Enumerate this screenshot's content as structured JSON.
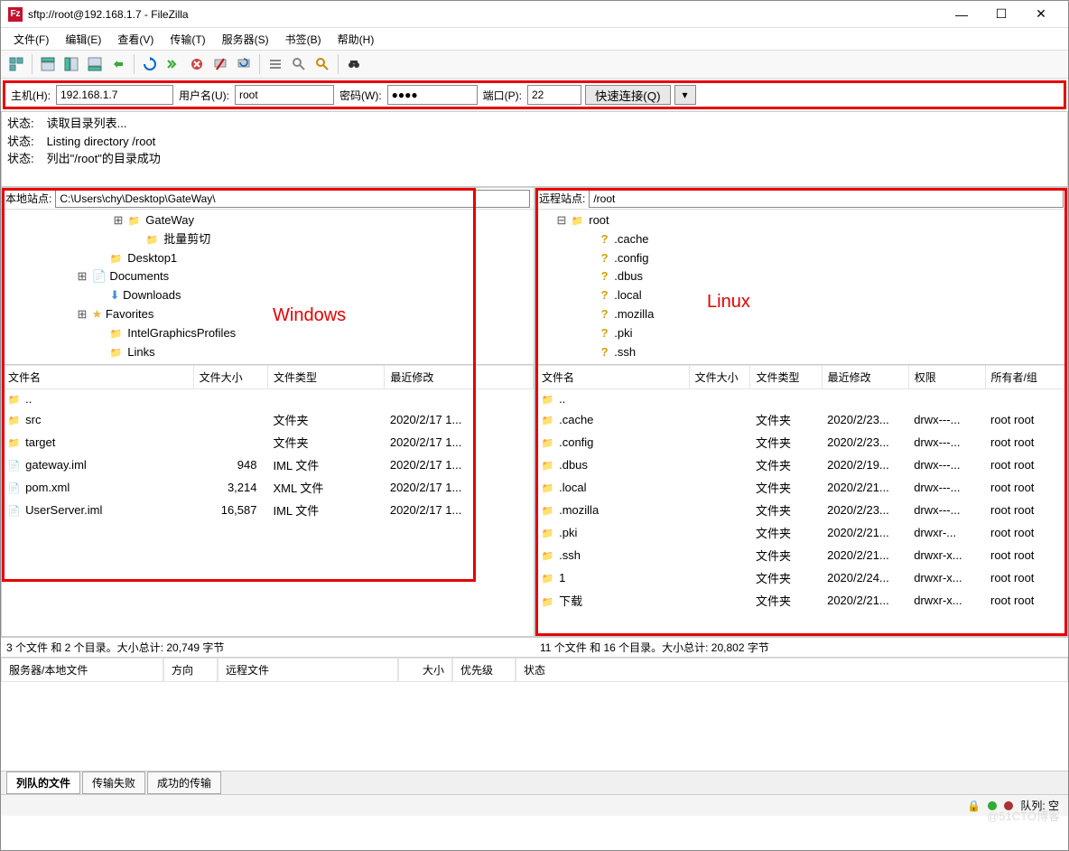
{
  "title": "sftp://root@192.168.1.7 - FileZilla",
  "menu": [
    "文件(F)",
    "编辑(E)",
    "查看(V)",
    "传输(T)",
    "服务器(S)",
    "书签(B)",
    "帮助(H)"
  ],
  "qc": {
    "host_label": "主机(H):",
    "host": "192.168.1.7",
    "user_label": "用户名(U):",
    "user": "root",
    "pass_label": "密码(W):",
    "pass": "●●●●",
    "port_label": "端口(P):",
    "port": "22",
    "connect": "快速连接(Q)"
  },
  "log": [
    {
      "k": "状态:",
      "v": "读取目录列表..."
    },
    {
      "k": "状态:",
      "v": "Listing directory /root"
    },
    {
      "k": "状态:",
      "v": "列出\"/root\"的目录成功"
    }
  ],
  "local": {
    "site_label": "本地站点:",
    "path": "C:\\Users\\chy\\Desktop\\GateWay\\",
    "annotation": "Windows",
    "tree": [
      {
        "indent": 120,
        "expand": "⊞",
        "icon": "folder",
        "name": "GateWay"
      },
      {
        "indent": 140,
        "expand": "",
        "icon": "folder",
        "name": "批量剪切"
      },
      {
        "indent": 100,
        "expand": "",
        "icon": "folder",
        "name": "Desktop1"
      },
      {
        "indent": 80,
        "expand": "⊞",
        "icon": "doc",
        "name": "Documents"
      },
      {
        "indent": 100,
        "expand": "",
        "icon": "down",
        "name": "Downloads"
      },
      {
        "indent": 80,
        "expand": "⊞",
        "icon": "fav",
        "name": "Favorites"
      },
      {
        "indent": 100,
        "expand": "",
        "icon": "folder",
        "name": "IntelGraphicsProfiles"
      },
      {
        "indent": 100,
        "expand": "",
        "icon": "folder",
        "name": "Links"
      }
    ],
    "cols": [
      "文件名",
      "文件大小",
      "文件类型",
      "最近修改"
    ],
    "files": [
      {
        "icon": "folder",
        "name": "..",
        "size": "",
        "type": "",
        "mod": ""
      },
      {
        "icon": "folder",
        "name": "src",
        "size": "",
        "type": "文件夹",
        "mod": "2020/2/17 1..."
      },
      {
        "icon": "folder",
        "name": "target",
        "size": "",
        "type": "文件夹",
        "mod": "2020/2/17 1..."
      },
      {
        "icon": "file",
        "name": "gateway.iml",
        "size": "948",
        "type": "IML 文件",
        "mod": "2020/2/17 1..."
      },
      {
        "icon": "file",
        "name": "pom.xml",
        "size": "3,214",
        "type": "XML 文件",
        "mod": "2020/2/17 1..."
      },
      {
        "icon": "file",
        "name": "UserServer.iml",
        "size": "16,587",
        "type": "IML 文件",
        "mod": "2020/2/17 1..."
      }
    ],
    "status": "3 个文件 和 2 个目录。大小总计: 20,749 字节"
  },
  "remote": {
    "site_label": "远程站点:",
    "path": "/root",
    "annotation": "Linux",
    "tree": [
      {
        "indent": 20,
        "expand": "⊟",
        "icon": "folder",
        "name": "root"
      },
      {
        "indent": 50,
        "expand": "",
        "icon": "q",
        "name": ".cache"
      },
      {
        "indent": 50,
        "expand": "",
        "icon": "q",
        "name": ".config"
      },
      {
        "indent": 50,
        "expand": "",
        "icon": "q",
        "name": ".dbus"
      },
      {
        "indent": 50,
        "expand": "",
        "icon": "q",
        "name": ".local"
      },
      {
        "indent": 50,
        "expand": "",
        "icon": "q",
        "name": ".mozilla"
      },
      {
        "indent": 50,
        "expand": "",
        "icon": "q",
        "name": ".pki"
      },
      {
        "indent": 50,
        "expand": "",
        "icon": "q",
        "name": ".ssh"
      }
    ],
    "cols": [
      "文件名",
      "文件大小",
      "文件类型",
      "最近修改",
      "权限",
      "所有者/组"
    ],
    "files": [
      {
        "icon": "folder",
        "name": "..",
        "size": "",
        "type": "",
        "mod": "",
        "perm": "",
        "own": ""
      },
      {
        "icon": "folder",
        "name": ".cache",
        "size": "",
        "type": "文件夹",
        "mod": "2020/2/23...",
        "perm": "drwx---...",
        "own": "root root"
      },
      {
        "icon": "folder",
        "name": ".config",
        "size": "",
        "type": "文件夹",
        "mod": "2020/2/23...",
        "perm": "drwx---...",
        "own": "root root"
      },
      {
        "icon": "folder",
        "name": ".dbus",
        "size": "",
        "type": "文件夹",
        "mod": "2020/2/19...",
        "perm": "drwx---...",
        "own": "root root"
      },
      {
        "icon": "folder",
        "name": ".local",
        "size": "",
        "type": "文件夹",
        "mod": "2020/2/21...",
        "perm": "drwx---...",
        "own": "root root"
      },
      {
        "icon": "folder",
        "name": ".mozilla",
        "size": "",
        "type": "文件夹",
        "mod": "2020/2/23...",
        "perm": "drwx---...",
        "own": "root root"
      },
      {
        "icon": "folder",
        "name": ".pki",
        "size": "",
        "type": "文件夹",
        "mod": "2020/2/21...",
        "perm": "drwxr-...",
        "own": "root root"
      },
      {
        "icon": "folder",
        "name": ".ssh",
        "size": "",
        "type": "文件夹",
        "mod": "2020/2/21...",
        "perm": "drwxr-x...",
        "own": "root root"
      },
      {
        "icon": "folder",
        "name": "1",
        "size": "",
        "type": "文件夹",
        "mod": "2020/2/24...",
        "perm": "drwxr-x...",
        "own": "root root"
      },
      {
        "icon": "folder",
        "name": "下载",
        "size": "",
        "type": "文件夹",
        "mod": "2020/2/21...",
        "perm": "drwxr-x...",
        "own": "root root"
      }
    ],
    "status": "11 个文件 和 16 个目录。大小总计: 20,802 字节"
  },
  "queue": {
    "cols": [
      "服务器/本地文件",
      "方向",
      "远程文件",
      "大小",
      "优先级",
      "状态"
    ],
    "tabs": [
      "列队的文件",
      "传输失败",
      "成功的传输"
    ]
  },
  "bottom": {
    "queue_label": "队列: 空"
  },
  "watermark": "@51CTO博客"
}
